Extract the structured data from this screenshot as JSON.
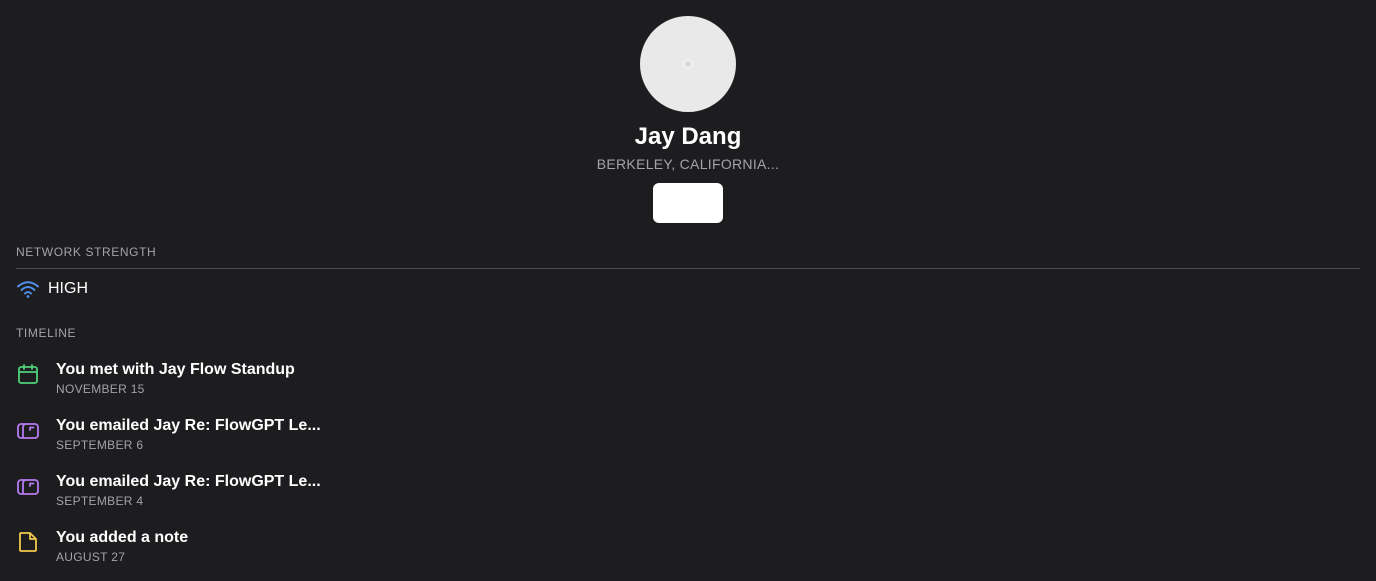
{
  "profile": {
    "name": "Jay Dang",
    "location": "BERKELEY, CALIFORNIA...",
    "action_button_label": ""
  },
  "network": {
    "label": "NETWORK STRENGTH",
    "value": "HIGH",
    "icon": "wifi-icon",
    "icon_color": "#4f8fe8"
  },
  "timeline": {
    "label": "TIMELINE",
    "items": [
      {
        "icon": "calendar-icon",
        "color": "#4fd17a",
        "title": "You met with Jay Flow Standup",
        "date": "NOVEMBER 15"
      },
      {
        "icon": "mailbox-icon",
        "color": "#b57bf0",
        "title": "You emailed Jay Re: FlowGPT Le...",
        "date": "SEPTEMBER 6"
      },
      {
        "icon": "mailbox-icon",
        "color": "#b57bf0",
        "title": "You emailed Jay Re: FlowGPT Le...",
        "date": "SEPTEMBER 4"
      },
      {
        "icon": "note-icon",
        "color": "#f2c94c",
        "title": "You added a note",
        "date": "AUGUST 27"
      }
    ]
  }
}
